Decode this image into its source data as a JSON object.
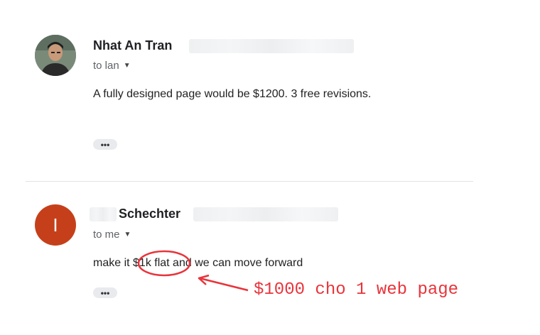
{
  "messages": [
    {
      "sender": "Nhat An Tran",
      "recipient": "to lan",
      "body": "A fully designed page would be $1200. 3 free revisions.",
      "more": "•••"
    },
    {
      "avatar_letter": "I",
      "sender": "Schechter",
      "recipient": "to me",
      "body_before": "make it ",
      "body_highlight": "$1k flat",
      "body_after": " and we can move forward",
      "more": "•••"
    }
  ],
  "annotation": {
    "text": "$1000 cho 1 web page",
    "color": "#e8343b"
  }
}
